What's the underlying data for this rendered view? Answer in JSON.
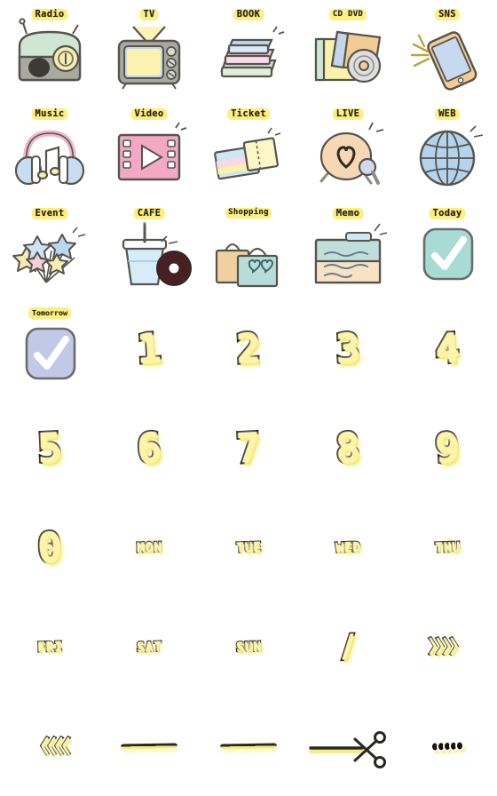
{
  "sheet": {
    "title": "Pastel Schedule Sticker Emoji Sheet",
    "background_color": "#ffffff",
    "columns": 5,
    "rows": 8,
    "label_color": "#fdf07f",
    "ink_color": "#241f16",
    "accent_yellow": "#f5e96a"
  },
  "items": [
    {
      "id": "radio",
      "label": "Radio",
      "kind": "icon",
      "row": 1,
      "col": 1,
      "colors": [
        "#c9e3cd",
        "#8f8f86",
        "#3a3a36"
      ]
    },
    {
      "id": "tv",
      "label": "TV",
      "kind": "icon",
      "row": 1,
      "col": 2,
      "colors": [
        "#b9cfe3",
        "#faf4b8",
        "#8a8a80"
      ]
    },
    {
      "id": "book",
      "label": "BOOK",
      "kind": "icon",
      "row": 1,
      "col": 3,
      "colors": [
        "#b9cfe9",
        "#f3c3d3",
        "#c6e2c6"
      ]
    },
    {
      "id": "cd-dvd",
      "label": "CD  DVD",
      "kind": "icon",
      "row": 1,
      "col": 4,
      "colors": [
        "#fbf1a8",
        "#f3c98f",
        "#cfcfcf"
      ]
    },
    {
      "id": "sns",
      "label": "SNS",
      "kind": "icon",
      "row": 1,
      "col": 5,
      "colors": [
        "#c3d6ef",
        "#f3c98f"
      ]
    },
    {
      "id": "music",
      "label": "Music",
      "kind": "icon",
      "row": 2,
      "col": 1,
      "colors": [
        "#f3b9cb",
        "#bcd8ef"
      ]
    },
    {
      "id": "video",
      "label": "Video",
      "kind": "icon",
      "row": 2,
      "col": 2,
      "colors": [
        "#f3a9c4",
        "#ffffff"
      ]
    },
    {
      "id": "ticket",
      "label": "Ticket",
      "kind": "icon",
      "row": 2,
      "col": 3,
      "colors": [
        "#bcd8ef",
        "#faf0a8",
        "#f3c3d3"
      ]
    },
    {
      "id": "live",
      "label": "LIVE",
      "kind": "icon",
      "row": 2,
      "col": 4,
      "colors": [
        "#f6d4ae",
        "#c9cde8"
      ]
    },
    {
      "id": "web",
      "label": "WEB",
      "kind": "icon",
      "row": 2,
      "col": 5,
      "colors": [
        "#aacce8",
        "#ffffff"
      ]
    },
    {
      "id": "event",
      "label": "Event",
      "kind": "icon",
      "row": 3,
      "col": 1,
      "colors": [
        "#faeeb2",
        "#bcd8ef",
        "#f3c3d3"
      ]
    },
    {
      "id": "cafe",
      "label": "CAFE",
      "kind": "icon",
      "row": 3,
      "col": 2,
      "colors": [
        "#cfe6f5",
        "#4a1f23"
      ]
    },
    {
      "id": "shopping",
      "label": "Shopping",
      "kind": "icon",
      "row": 3,
      "col": 3,
      "colors": [
        "#f0cfa0",
        "#b8ddd8"
      ]
    },
    {
      "id": "memo",
      "label": "Memo",
      "kind": "icon",
      "row": 3,
      "col": 4,
      "colors": [
        "#b8ddd8",
        "#f6e0c0"
      ]
    },
    {
      "id": "today",
      "label": "Today",
      "kind": "check",
      "row": 3,
      "col": 5,
      "colors": [
        "#a8dbd6",
        "#ffffff"
      ]
    },
    {
      "id": "tomorrow",
      "label": "Tomorrow",
      "kind": "check",
      "row": 4,
      "col": 1,
      "colors": [
        "#c2c8e8",
        "#ffffff"
      ]
    },
    {
      "id": "num-1",
      "label": "1",
      "kind": "number",
      "row": 4,
      "col": 2
    },
    {
      "id": "num-2",
      "label": "2",
      "kind": "number",
      "row": 4,
      "col": 3
    },
    {
      "id": "num-3",
      "label": "3",
      "kind": "number",
      "row": 4,
      "col": 4
    },
    {
      "id": "num-4",
      "label": "4",
      "kind": "number",
      "row": 4,
      "col": 5
    },
    {
      "id": "num-5",
      "label": "5",
      "kind": "number",
      "row": 5,
      "col": 1
    },
    {
      "id": "num-6",
      "label": "6",
      "kind": "number",
      "row": 5,
      "col": 2
    },
    {
      "id": "num-7",
      "label": "7",
      "kind": "number",
      "row": 5,
      "col": 3
    },
    {
      "id": "num-8",
      "label": "8",
      "kind": "number",
      "row": 5,
      "col": 4
    },
    {
      "id": "num-9",
      "label": "9",
      "kind": "number",
      "row": 5,
      "col": 5
    },
    {
      "id": "num-0",
      "label": "0",
      "kind": "number",
      "row": 6,
      "col": 1
    },
    {
      "id": "day-mon",
      "label": "MON",
      "kind": "day",
      "row": 6,
      "col": 2
    },
    {
      "id": "day-tue",
      "label": "TUE",
      "kind": "day",
      "row": 6,
      "col": 3
    },
    {
      "id": "day-wed",
      "label": "WED",
      "kind": "day",
      "row": 6,
      "col": 4
    },
    {
      "id": "day-thu",
      "label": "THU",
      "kind": "day",
      "row": 6,
      "col": 5
    },
    {
      "id": "day-fri",
      "label": "FRI",
      "kind": "day",
      "row": 7,
      "col": 1
    },
    {
      "id": "day-sat",
      "label": "SAT",
      "kind": "day",
      "row": 7,
      "col": 2
    },
    {
      "id": "day-sun",
      "label": "SUN",
      "kind": "day",
      "row": 7,
      "col": 3
    },
    {
      "id": "slash",
      "label": "/",
      "kind": "slash",
      "row": 7,
      "col": 4
    },
    {
      "id": "arrows-right",
      "label": "〉〉〉〉",
      "kind": "sym",
      "row": 7,
      "col": 5
    },
    {
      "id": "arrows-left",
      "label": "〈〈〈〈",
      "kind": "sym",
      "row": 8,
      "col": 1
    },
    {
      "id": "line-1",
      "label": "",
      "kind": "rule",
      "row": 8,
      "col": 2
    },
    {
      "id": "line-2",
      "label": "",
      "kind": "rule",
      "row": 8,
      "col": 3
    },
    {
      "id": "cut-line",
      "label": "",
      "kind": "scissors",
      "row": 8,
      "col": 4
    },
    {
      "id": "dots",
      "label": "",
      "kind": "dots",
      "row": 8,
      "col": 5
    }
  ]
}
